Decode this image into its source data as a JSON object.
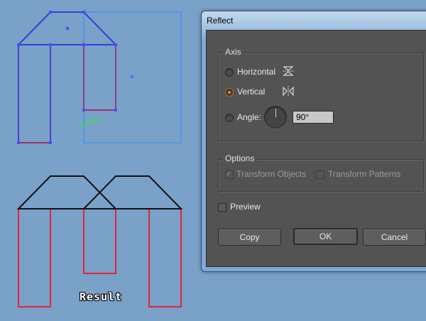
{
  "artboard": {
    "path_label": "path",
    "result_label": "Result"
  },
  "dialog": {
    "title": "Reflect",
    "axis": {
      "legend": "Axis",
      "horizontal_label": "Horizontal",
      "vertical_label": "Vertical",
      "angle_label": "Angle:",
      "angle_value": "90°",
      "selected": "Vertical"
    },
    "options": {
      "legend": "Options",
      "transform_objects_label": "Transform Objects",
      "transform_patterns_label": "Transform Patterns"
    },
    "preview_label": "Preview",
    "buttons": {
      "copy": "Copy",
      "ok": "OK",
      "cancel": "Cancel"
    }
  },
  "colors": {
    "background": "#7aa1c8",
    "selection_blue": "#4a6cff",
    "path_purple": "#8a3d9a",
    "result_red": "#e32636",
    "dialog_body": "#535353",
    "radio_accent": "#e48a2f"
  }
}
